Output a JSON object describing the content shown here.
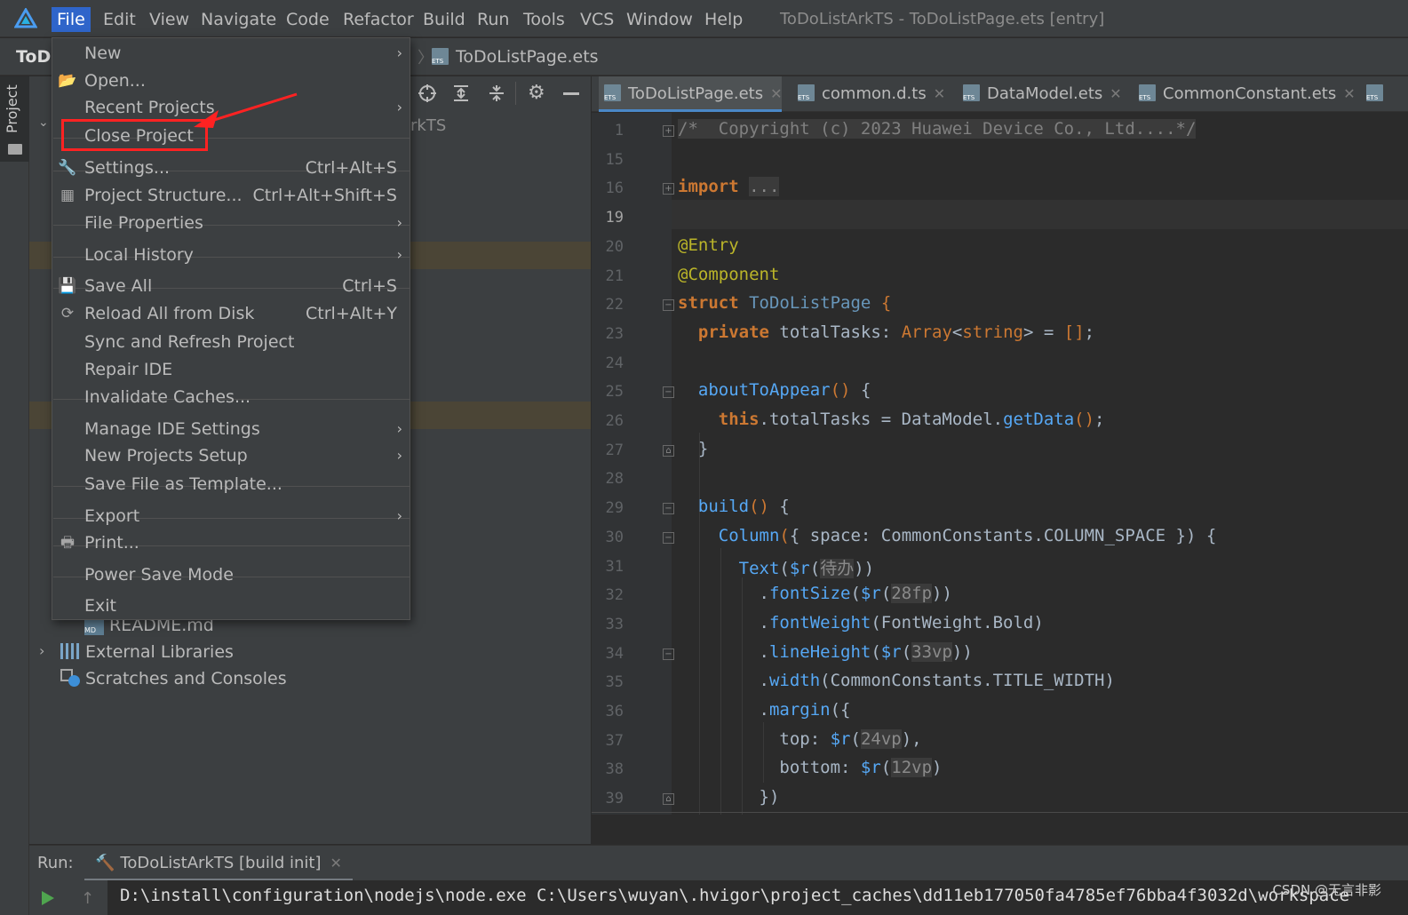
{
  "app": {
    "window_title": "ToDoListArkTS - ToDoListPage.ets [entry]",
    "project_short": "ToD",
    "breadcrumb_file": "ToDoListPage.ets",
    "project_node_suffix": "rkTS"
  },
  "menubar": [
    "File",
    "Edit",
    "View",
    "Navigate",
    "Code",
    "Refactor",
    "Build",
    "Run",
    "Tools",
    "VCS",
    "Window",
    "Help"
  ],
  "sidebar": {
    "project_tab": "Project"
  },
  "file_menu": {
    "items": [
      {
        "label": "New",
        "shortcut": "",
        "submenu": true,
        "icon": ""
      },
      {
        "label": "Open...",
        "shortcut": "",
        "submenu": false,
        "icon": "folder-open-icon"
      },
      {
        "label": "Recent Projects",
        "shortcut": "",
        "submenu": true,
        "icon": ""
      },
      {
        "label": "Close Project",
        "shortcut": "",
        "submenu": false,
        "icon": ""
      },
      {
        "label": "Settings...",
        "shortcut": "Ctrl+Alt+S",
        "submenu": false,
        "icon": "wrench-icon"
      },
      {
        "label": "Project Structure...",
        "shortcut": "Ctrl+Alt+Shift+S",
        "submenu": false,
        "icon": "project-structure-icon"
      },
      {
        "label": "File Properties",
        "shortcut": "",
        "submenu": true,
        "icon": ""
      },
      {
        "label": "Local History",
        "shortcut": "",
        "submenu": true,
        "icon": ""
      },
      {
        "label": "Save All",
        "shortcut": "Ctrl+S",
        "submenu": false,
        "icon": "save-icon"
      },
      {
        "label": "Reload All from Disk",
        "shortcut": "Ctrl+Alt+Y",
        "submenu": false,
        "icon": "reload-icon"
      },
      {
        "label": "Sync and Refresh Project",
        "shortcut": "",
        "submenu": false,
        "icon": ""
      },
      {
        "label": "Repair IDE",
        "shortcut": "",
        "submenu": false,
        "icon": ""
      },
      {
        "label": "Invalidate Caches...",
        "shortcut": "",
        "submenu": false,
        "icon": ""
      },
      {
        "label": "Manage IDE Settings",
        "shortcut": "",
        "submenu": true,
        "icon": ""
      },
      {
        "label": "New Projects Setup",
        "shortcut": "",
        "submenu": true,
        "icon": ""
      },
      {
        "label": "Save File as Template...",
        "shortcut": "",
        "submenu": false,
        "icon": ""
      },
      {
        "label": "Export",
        "shortcut": "",
        "submenu": true,
        "icon": ""
      },
      {
        "label": "Print...",
        "shortcut": "",
        "submenu": false,
        "icon": "printer-icon"
      },
      {
        "label": "Power Save Mode",
        "shortcut": "",
        "submenu": false,
        "icon": ""
      },
      {
        "label": "Exit",
        "shortcut": "",
        "submenu": false,
        "icon": ""
      }
    ]
  },
  "project_tree": [
    {
      "label": "README.md",
      "icon": "markdown-file-icon"
    },
    {
      "label": "External Libraries",
      "icon": "libraries-icon"
    },
    {
      "label": "Scratches and Consoles",
      "icon": "scratches-icon"
    }
  ],
  "editor_tabs": [
    {
      "label": "ToDoListPage.ets",
      "active": true
    },
    {
      "label": "common.d.ts",
      "active": false
    },
    {
      "label": "DataModel.ets",
      "active": false
    },
    {
      "label": "CommonConstant.ets",
      "active": false
    }
  ],
  "code_lines": [
    {
      "n": "1",
      "text": "/*  Copyright (c) 2023 Huawei Device Co., Ltd....*/"
    },
    {
      "n": "15",
      "text": ""
    },
    {
      "n": "16",
      "text": "import ..."
    },
    {
      "n": "19",
      "text": ""
    },
    {
      "n": "20",
      "text": "@Entry"
    },
    {
      "n": "21",
      "text": "@Component"
    },
    {
      "n": "22",
      "text": "struct ToDoListPage {"
    },
    {
      "n": "23",
      "text": "  private totalTasks: Array<string> = [];"
    },
    {
      "n": "24",
      "text": ""
    },
    {
      "n": "25",
      "text": "  aboutToAppear() {"
    },
    {
      "n": "26",
      "text": "    this.totalTasks = DataModel.getData();"
    },
    {
      "n": "27",
      "text": "  }"
    },
    {
      "n": "28",
      "text": ""
    },
    {
      "n": "29",
      "text": "  build() {"
    },
    {
      "n": "30",
      "text": "    Column({ space: CommonConstants.COLUMN_SPACE }) {"
    },
    {
      "n": "31",
      "text": "      Text($r(待办))"
    },
    {
      "n": "32",
      "text": "        .fontSize($r(28fp))"
    },
    {
      "n": "33",
      "text": "        .fontWeight(FontWeight.Bold)"
    },
    {
      "n": "34",
      "text": "        .lineHeight($r(33vp))"
    },
    {
      "n": "35",
      "text": "        .width(CommonConstants.TITLE_WIDTH)"
    },
    {
      "n": "36",
      "text": "        .margin({"
    },
    {
      "n": "37",
      "text": "          top: $r(24vp),"
    },
    {
      "n": "38",
      "text": "          bottom: $r(12vp)"
    },
    {
      "n": "39",
      "text": "        })"
    }
  ],
  "run": {
    "label": "Run:",
    "config": "ToDoListArkTS [build init]",
    "console_line": "D:\\install\\configuration\\nodejs\\node.exe C:\\Users\\wuyan\\.hvigor\\project_caches\\dd11eb177050fa4785ef76bba4f3032d\\workspace"
  },
  "watermark": "CSDN @无言非影",
  "colors": {
    "menu_active": "#2f65ca",
    "highlight_box": "#ff2222",
    "keyword": "#cc7832",
    "annotation": "#bbb529",
    "function": "#56a8f5"
  }
}
